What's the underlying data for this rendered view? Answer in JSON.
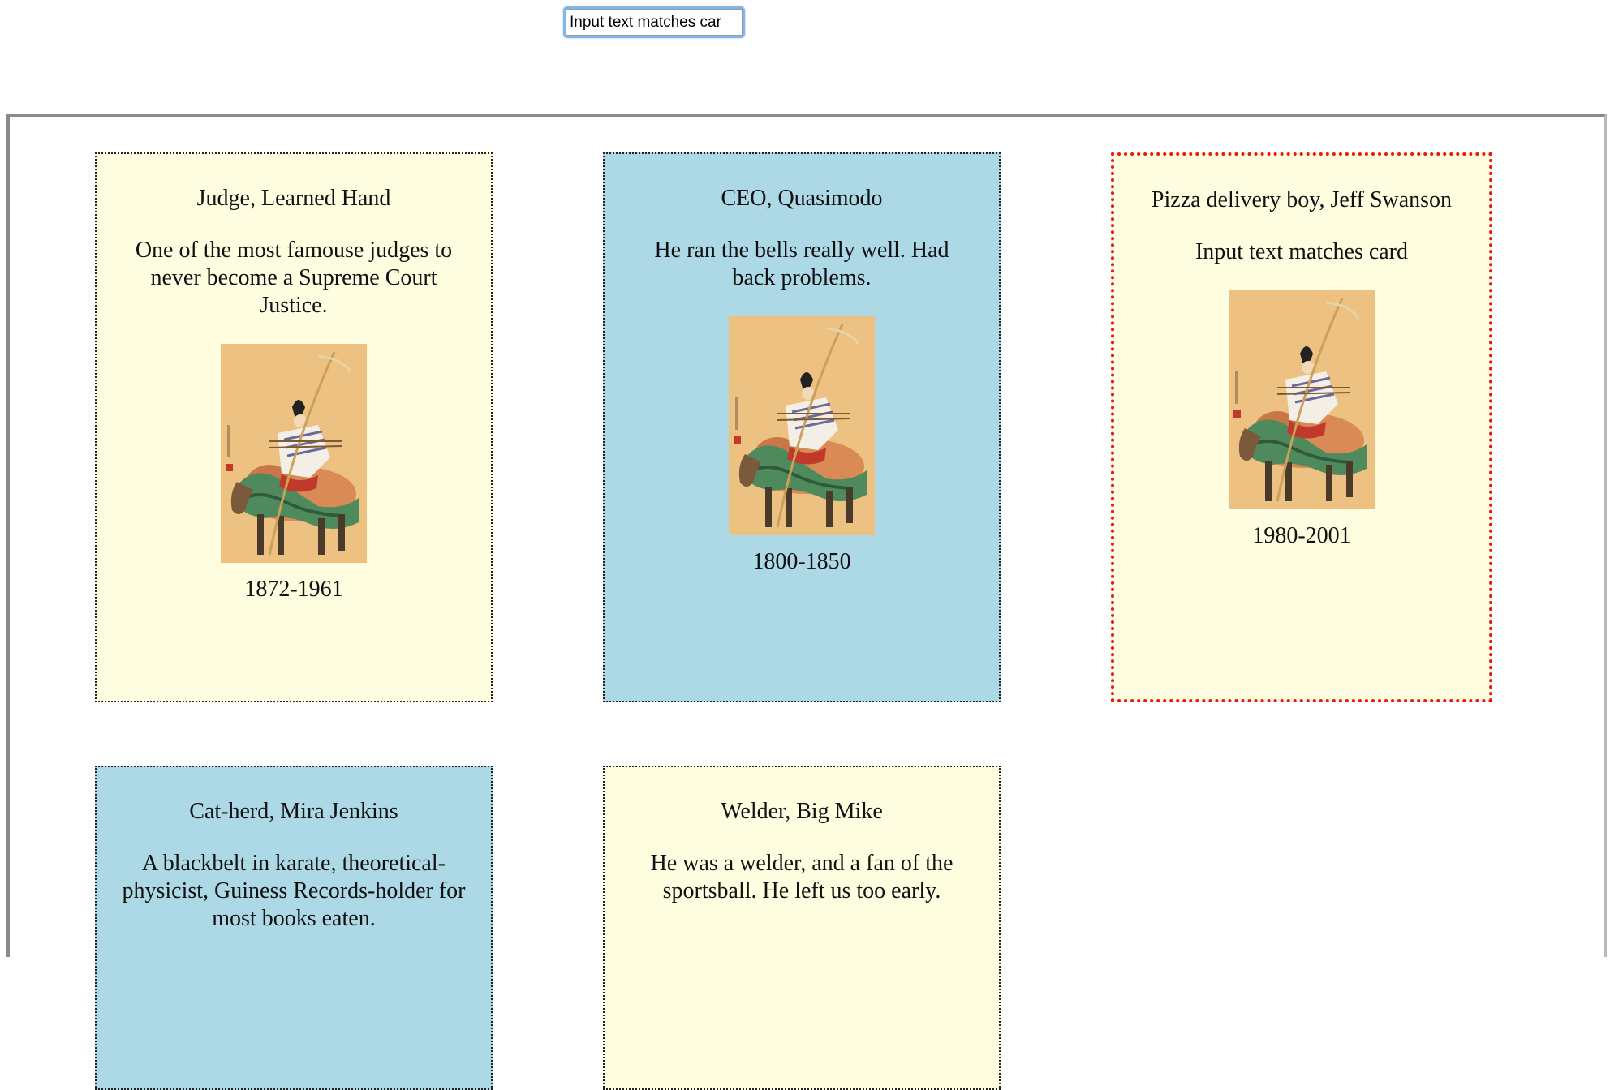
{
  "search": {
    "value": "Input text matches car"
  },
  "cards": [
    {
      "title": "Judge, Learned Hand",
      "description": "One of the most famouse judges to never become a Supreme Court Justice.",
      "years": "1872-1961",
      "background": "#fffde0"
    },
    {
      "title": "CEO, Quasimodo",
      "description": "He ran the bells really well. Had back problems.",
      "years": "1800-1850",
      "background": "#add8e6"
    },
    {
      "title": "Pizza delivery boy, Jeff Swanson",
      "description": "Input text matches card",
      "years": "1980-2001",
      "background": "#fffde0",
      "highlight_border": "#e81818"
    },
    {
      "title": "Cat-herd, Mira Jenkins",
      "description": "A blackbelt in karate, theoretical-physicist, Guiness Records-holder for most books eaten.",
      "background": "#add8e6"
    },
    {
      "title": "Welder, Big Mike",
      "description": "He was a welder, and a fan of the sportsball. He left us too early.",
      "background": "#fffde0"
    }
  ]
}
